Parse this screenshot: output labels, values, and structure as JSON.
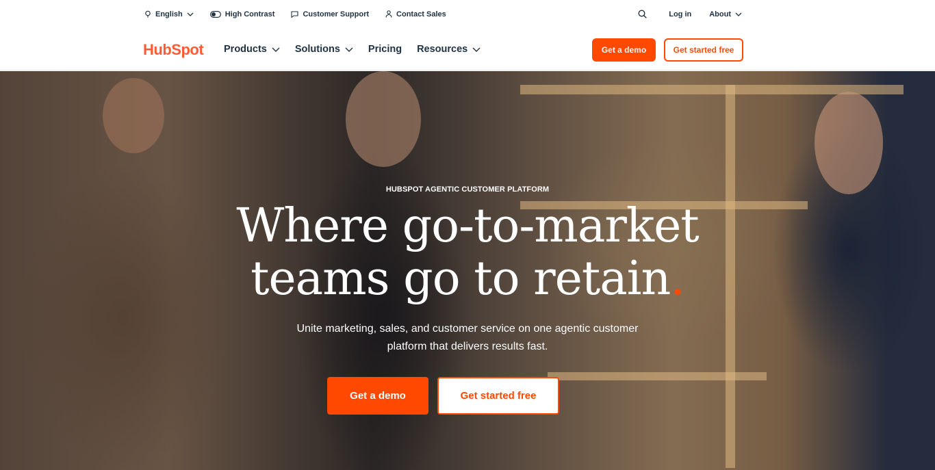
{
  "utility": {
    "language": "English",
    "high_contrast": "High Contrast",
    "customer_support": "Customer Support",
    "contact_sales": "Contact Sales",
    "login": "Log in",
    "about": "About"
  },
  "nav": {
    "logo": "HubSpot",
    "items": [
      {
        "label": "Products",
        "has_dropdown": true
      },
      {
        "label": "Solutions",
        "has_dropdown": true
      },
      {
        "label": "Pricing",
        "has_dropdown": false
      },
      {
        "label": "Resources",
        "has_dropdown": true
      }
    ],
    "demo_button": "Get a demo",
    "start_button": "Get started free"
  },
  "hero": {
    "eyebrow": "HUBSPOT AGENTIC CUSTOMER PLATFORM",
    "headline_line1": "Where go-to-market",
    "headline_line2": "teams go to retain",
    "headline_period": ".",
    "subcopy": "Unite marketing, sales, and customer service on one agentic customer platform that delivers results fast.",
    "demo_button": "Get a demo",
    "start_button": "Get started free"
  },
  "colors": {
    "brand_orange": "#ff4800",
    "logo_orange": "#ff5c35",
    "text_dark": "#213343"
  },
  "icons": {
    "language": "globe-icon",
    "high_contrast": "contrast-toggle-icon",
    "customer_support": "chat-bubble-icon",
    "contact_sales": "person-icon",
    "search": "search-icon",
    "dropdown": "chevron-down-icon"
  }
}
